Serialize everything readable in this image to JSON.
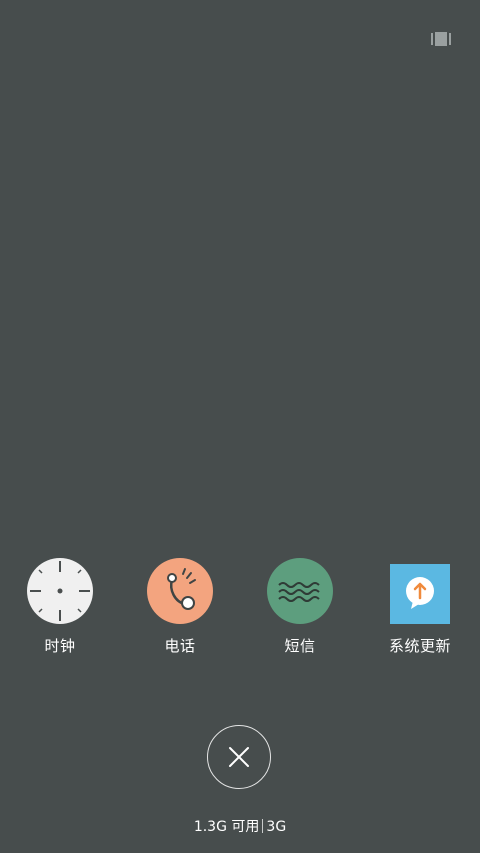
{
  "topbar": {
    "icon": "recent-apps-list-icon"
  },
  "apps": [
    {
      "label": "时钟",
      "icon": "clock-icon",
      "color": "#f0f0f0"
    },
    {
      "label": "电话",
      "icon": "phone-icon",
      "color": "#f3a47f"
    },
    {
      "label": "短信",
      "icon": "messages-icon",
      "color": "#5d9e7e"
    },
    {
      "label": "系统更新",
      "icon": "system-update-icon",
      "color": "#5bb8e2"
    }
  ],
  "close": {
    "icon": "close-icon"
  },
  "memory": {
    "available": "1.3G 可用",
    "total": "3G"
  },
  "colors": {
    "background": "#474d4d"
  }
}
